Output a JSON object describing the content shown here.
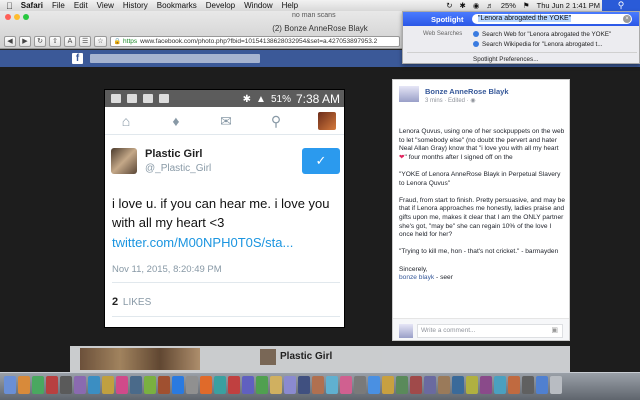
{
  "menubar": {
    "items": [
      "Safari",
      "File",
      "Edit",
      "View",
      "History",
      "Bookmarks",
      "Develop",
      "Window",
      "Help"
    ],
    "battery": "25%",
    "clock": "Thu Jun 2  1:41 PM"
  },
  "browser": {
    "small_tab_title": "no man scans",
    "window_title": "(2) Bonze AnneRose Blayk",
    "url_scheme": "https",
    "url": "www.facebook.com/photo.php?fbid=10154138628032954&set=a.427053897953.2"
  },
  "facebook": {
    "logo": "f",
    "bg_post_name": "Plastic Girl"
  },
  "tweet": {
    "status_time": "7:38 AM",
    "status_battery": "51%",
    "name": "Plastic Girl",
    "handle": "@_Plastic_Girl",
    "text": "i love u. if you can hear me. i love you with all my heart <3",
    "link": "twitter.com/M00NPH0T0S/sta...",
    "date": "Nov 11, 2015, 8:20:49 PM",
    "likes_count": "2",
    "likes_label": "LIKES"
  },
  "fbpost": {
    "author": "Bonze AnneRose Blayk",
    "meta": "3 mins · Edited · ",
    "paragraph1_a": "Lenora Quvus, using one of her sockpuppets on the web to let \"somebody else\" (no doubt the pervert and hater Neal Allan Gray) know that \"i love you with all my heart ",
    "paragraph1_b": "\" four months after I signed off on the",
    "paragraph2": "\"YOKE of Lenora AnneRose Blayk in Perpetual Slavery to Lenora Quvus\"",
    "paragraph3": "Fraud, from start to finish. Pretty persuasive, and may be that if Lenora approaches me honestly, ladies praise and gifts upon me, makes it clear that I am the ONLY partner she's got, \"may be\" she can regain 10% of the love I once held for her?",
    "paragraph4": "\"Trying to kill me, hon - that's not cricket.\" - barmayden",
    "closing": "Sincerely,",
    "signature": "bonze blayk",
    "signature_suffix": " - seer",
    "comment_placeholder": "Write a comment..."
  },
  "spotlight": {
    "label": "Spotlight",
    "query": "\"Lenora abrogated the YOKE\"",
    "category": "Web Searches",
    "result1": "Search Web for \"Lenora abrogated the YOKE\"",
    "result2": "Search Wikipedia for \"Lenora abrogated t...",
    "prefs": "Spotlight Preferences..."
  },
  "colors": {
    "facebook_blue": "#3b5998",
    "twitter_blue": "#1b95e0",
    "spotlight_blue": "#2b57e6"
  }
}
